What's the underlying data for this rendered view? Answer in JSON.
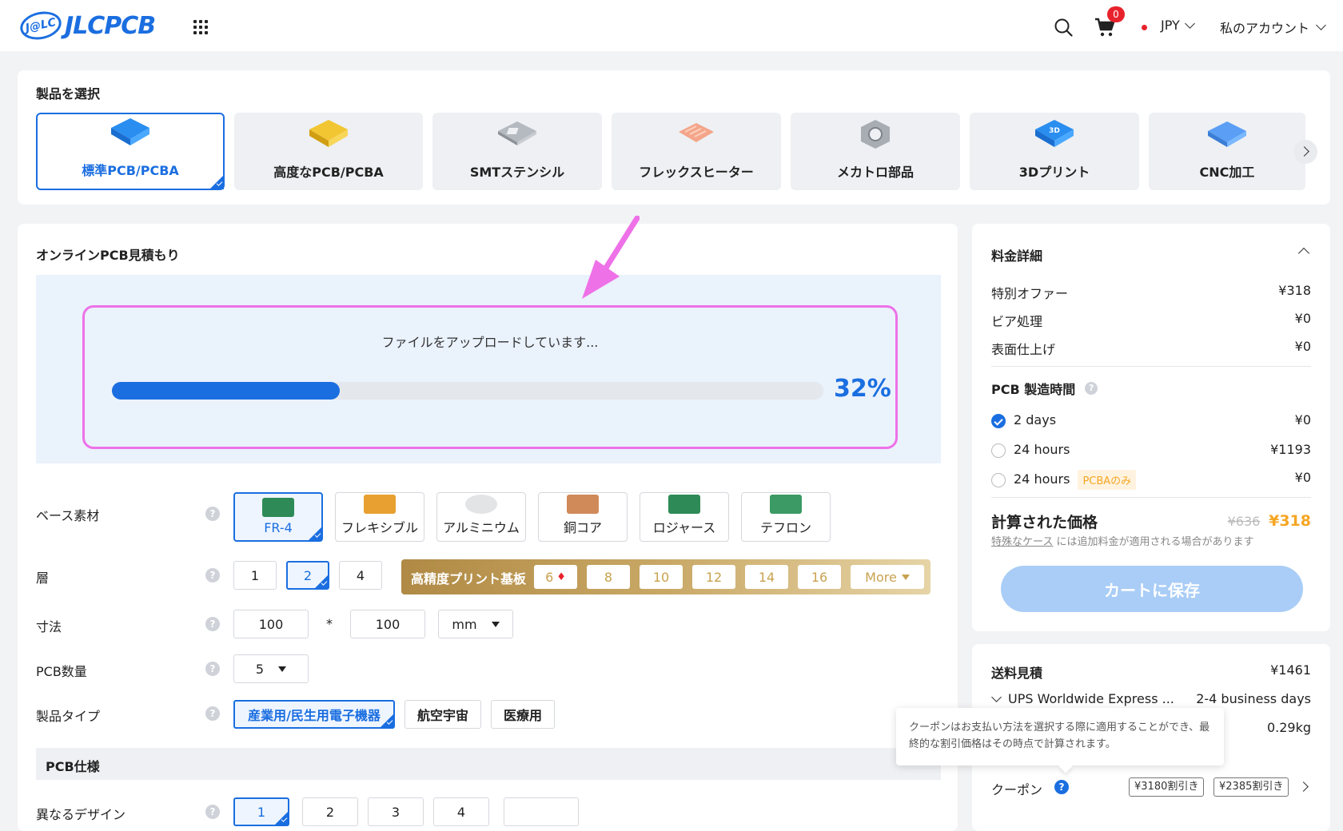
{
  "header": {
    "logo_mark": "J@LC",
    "logo_text": "JLCPCB",
    "cart_count": "0",
    "currency": "JPY",
    "account": "私のアカウント"
  },
  "products": {
    "title": "製品を選択",
    "items": [
      {
        "label": "標準PCB/PCBA",
        "icon": "pcb-standard-icon",
        "color": "#2a8ef0"
      },
      {
        "label": "高度なPCB/PCBA",
        "icon": "pcb-advanced-icon",
        "color": "#e8b820"
      },
      {
        "label": "SMTステンシル",
        "icon": "smt-stencil-icon",
        "color": "#9aa0a8"
      },
      {
        "label": "フレックスヒーター",
        "icon": "flex-heater-icon",
        "color": "#f4a58a"
      },
      {
        "label": "メカトロ部品",
        "icon": "nut-icon",
        "color": "#9aa0a8"
      },
      {
        "label": "3Dプリント",
        "icon": "3d-print-icon",
        "color": "#2a8ef0"
      },
      {
        "label": "CNC加工",
        "icon": "cnc-icon",
        "color": "#5a9ef5"
      }
    ]
  },
  "quote": {
    "title": "オンラインPCB見積もり",
    "upload_text": "ファイルをアップロードしています...",
    "progress": 0.32,
    "progress_label": "32%"
  },
  "form": {
    "base_material": {
      "label": "ベース素材",
      "options": [
        "FR-4",
        "フレキシブル",
        "アルミニウム",
        "銅コア",
        "ロジャース",
        "テフロン"
      ],
      "selected": "FR-4"
    },
    "layers": {
      "label": "層",
      "options": [
        "1",
        "2",
        "4"
      ],
      "selected": "2",
      "high_precision": {
        "label": "高精度プリント基板",
        "options": [
          "6",
          "8",
          "10",
          "12",
          "14",
          "16"
        ],
        "more": "More"
      }
    },
    "dimensions": {
      "label": "寸法",
      "width": "100",
      "sep": "*",
      "height": "100",
      "unit": "mm"
    },
    "quantity": {
      "label": "PCB数量",
      "value": "5"
    },
    "product_type": {
      "label": "製品タイプ",
      "options": [
        "産業用/民生用電子機器",
        "航空宇宙",
        "医療用"
      ],
      "selected": "産業用/民生用電子機器"
    },
    "spec_title": "PCB仕様",
    "designs": {
      "label": "異なるデザイン",
      "options": [
        "1",
        "2",
        "3",
        "4",
        ""
      ],
      "selected": "1"
    },
    "help": "?"
  },
  "price": {
    "title": "料金詳細",
    "rows": [
      {
        "label": "特別オファー",
        "value": "¥318"
      },
      {
        "label": "ビア処理",
        "value": "¥0"
      },
      {
        "label": "表面仕上げ",
        "value": "¥0"
      }
    ],
    "build_time_title": "PCB 製造時間",
    "build_times": [
      {
        "label": "2 days",
        "value": "¥0",
        "checked": true,
        "tag": ""
      },
      {
        "label": "24 hours",
        "value": "¥1193",
        "checked": false,
        "tag": ""
      },
      {
        "label": "24 hours",
        "value": "¥0",
        "checked": false,
        "tag": "PCBAのみ"
      }
    ],
    "calc_label": "計算された価格",
    "old_price": "¥636",
    "new_price": "¥318",
    "note_link": "特殊なケース",
    "note_rest": " には追加料金が適用される場合があります",
    "cart_button": "カートに保存"
  },
  "shipping": {
    "title": "送料見積",
    "cost": "¥1461",
    "method": "UPS Worldwide Express ...",
    "days": "2-4 business days",
    "weight": "0.29kg",
    "tooltip": "クーポンはお支払い方法を選択する際に適用することができ、最終的な割引価格はその時点で計算されます。",
    "coupon_label": "クーポン",
    "coupons": [
      "¥3180割引き",
      "¥2385割引き"
    ]
  }
}
